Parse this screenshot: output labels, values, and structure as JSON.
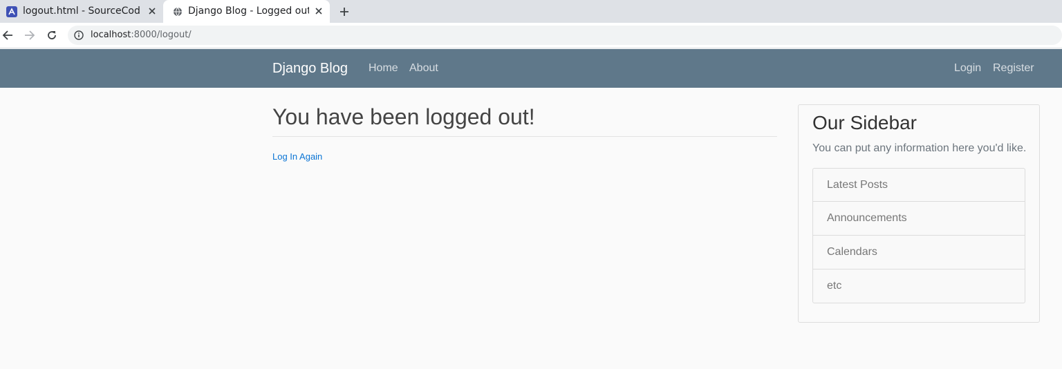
{
  "browser": {
    "tabs": [
      {
        "title": "logout.html - SourceCode",
        "active": false
      },
      {
        "title": "Django Blog - Logged out",
        "active": true
      }
    ],
    "url": {
      "host": "localhost",
      "rest": ":8000/logout/"
    }
  },
  "site_nav": {
    "brand": "Django Blog",
    "left_links": [
      "Home",
      "About"
    ],
    "right_links": [
      "Login",
      "Register"
    ],
    "color": "#5f788a"
  },
  "main": {
    "title": "You have been logged out!",
    "link": "Log In Again",
    "link_color": "#0a74d4"
  },
  "sidebar": {
    "title": "Our Sidebar",
    "text": "You can put any information here you'd like.",
    "items": [
      "Latest Posts",
      "Announcements",
      "Calendars",
      "etc"
    ]
  }
}
